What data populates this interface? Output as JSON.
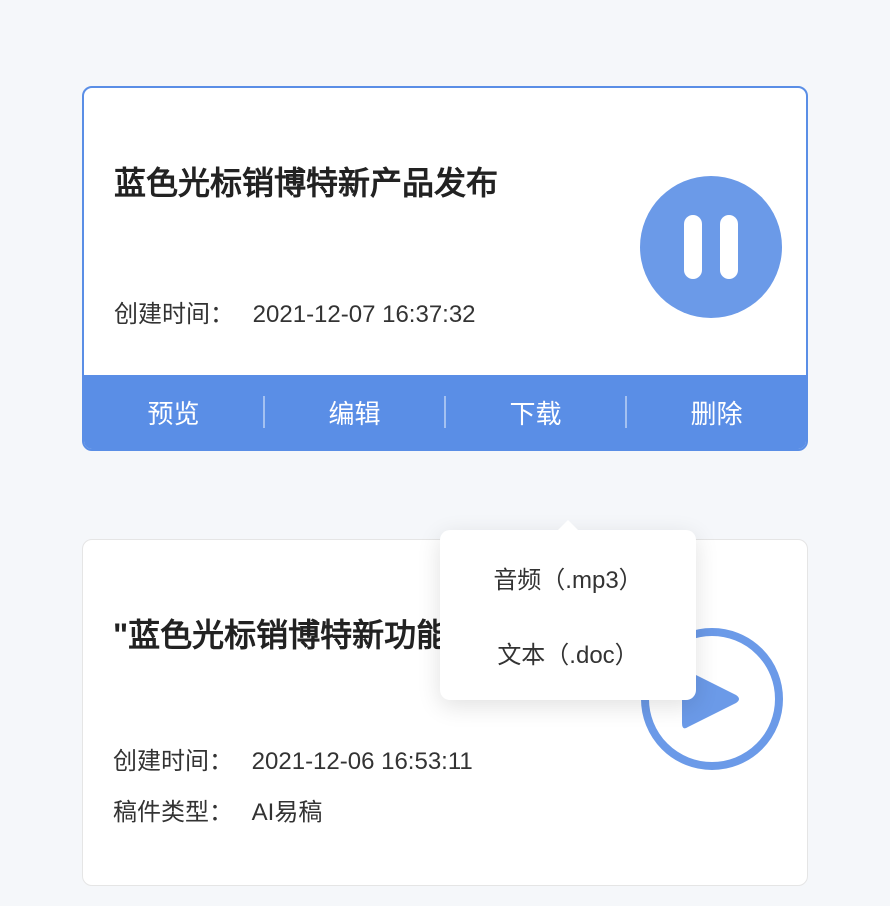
{
  "cards": [
    {
      "title": "蓝色光标销博特新产品发布",
      "created_label": "创建时间：",
      "created_value": "2021-12-07 16:37:32",
      "play_state": "pause"
    },
    {
      "title": "\"蓝色光标销博特新功能发布会",
      "created_label": "创建时间：",
      "created_value": "2021-12-06 16:53:11",
      "type_label": "稿件类型：",
      "type_value": "AI易稿",
      "play_state": "play"
    }
  ],
  "actions": {
    "preview": "预览",
    "edit": "编辑",
    "download": "下载",
    "delete": "删除"
  },
  "dropdown": {
    "audio": "音频（.mp3）",
    "text": "文本（.doc）"
  }
}
